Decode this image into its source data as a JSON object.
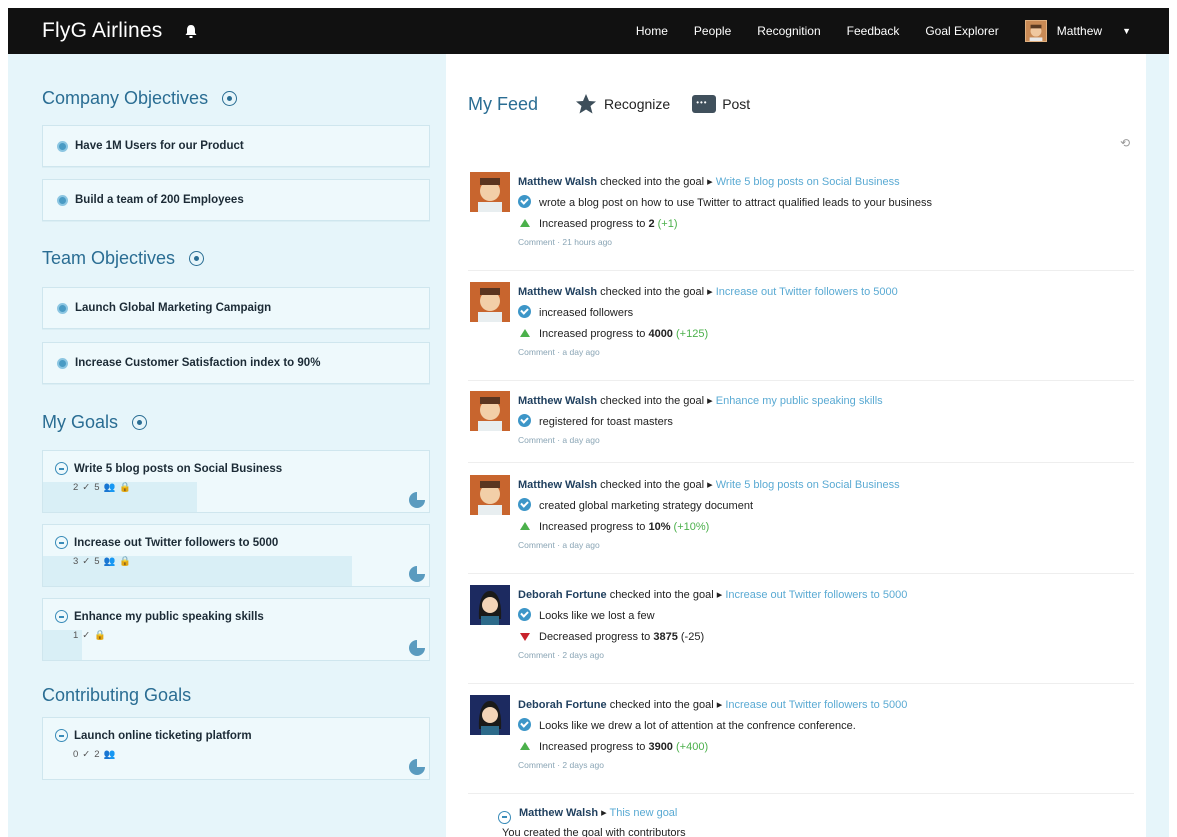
{
  "header": {
    "brand": "FlyG Airlines",
    "nav": [
      "Home",
      "People",
      "Recognition",
      "Feedback",
      "Goal Explorer"
    ],
    "user_name": "Matthew"
  },
  "sidebar": {
    "company_title": "Company Objectives",
    "company_items": [
      "Have 1M Users for our Product",
      "Build a team of 200 Employees"
    ],
    "team_title": "Team Objectives",
    "team_items": [
      "Launch Global Marketing Campaign",
      "Increase Customer Satisfaction index to 90%"
    ],
    "goals_title": "My Goals",
    "goals": [
      {
        "label": "Write 5 blog posts on Social Business",
        "checkins": "2",
        "contributors": "5",
        "progress": 0.4
      },
      {
        "label": "Increase out Twitter followers to 5000",
        "checkins": "3",
        "contributors": "5",
        "progress": 0.8
      },
      {
        "label": "Enhance my public speaking skills",
        "checkins": "1",
        "contributors": "",
        "progress": 0.1
      }
    ],
    "contributing_title": "Contributing Goals",
    "contributing": [
      {
        "label": "Launch online ticketing platform",
        "checkins": "0",
        "contributors": "2",
        "progress": 0
      }
    ]
  },
  "feed": {
    "title": "My Feed",
    "recognize": "Recognize",
    "post": "Post",
    "verb": "checked into the goal",
    "entries": [
      {
        "name": "Matthew Walsh",
        "goal": "Write 5 blog posts on Social Business",
        "note": "wrote a blog post on how to use Twitter to attract qualified leads to your business",
        "change": "Increased progress to",
        "value": "2",
        "delta": "(+1)",
        "meta": "Comment · 21 hours ago"
      },
      {
        "name": "Matthew Walsh",
        "goal": "Increase out Twitter followers to 5000",
        "note": "increased followers",
        "change": "Increased progress to",
        "value": "4000",
        "delta": "(+125)",
        "meta": "Comment · a day ago"
      },
      {
        "name": "Matthew Walsh",
        "goal": "Enhance my public speaking skills",
        "note": "registered for toast masters",
        "meta": "Comment · a day ago"
      },
      {
        "name": "Matthew Walsh",
        "goal": "Write 5 blog posts on Social Business",
        "note": "created global marketing strategy document",
        "change": "Increased progress to",
        "value": "10%",
        "delta": "(+10%)",
        "meta": "Comment · a day ago"
      },
      {
        "name": "Deborah Fortune",
        "goal": "Increase out Twitter followers to 5000",
        "note": "Looks like we lost a few",
        "change": "Decreased progress to",
        "value": "3875",
        "delta": "(-25)",
        "meta": "Comment · 2 days ago"
      },
      {
        "name": "Deborah Fortune",
        "goal": "Increase out Twitter followers to 5000",
        "note": "Looks like we drew a lot of attention at the confrence conference.",
        "change": "Increased progress to",
        "value": "3900",
        "delta": "(+400)",
        "meta": "Comment · 2 days ago"
      }
    ],
    "last": {
      "name": "Matthew Walsh",
      "goal": "This new goal",
      "text": "You created the goal with contributors"
    }
  }
}
